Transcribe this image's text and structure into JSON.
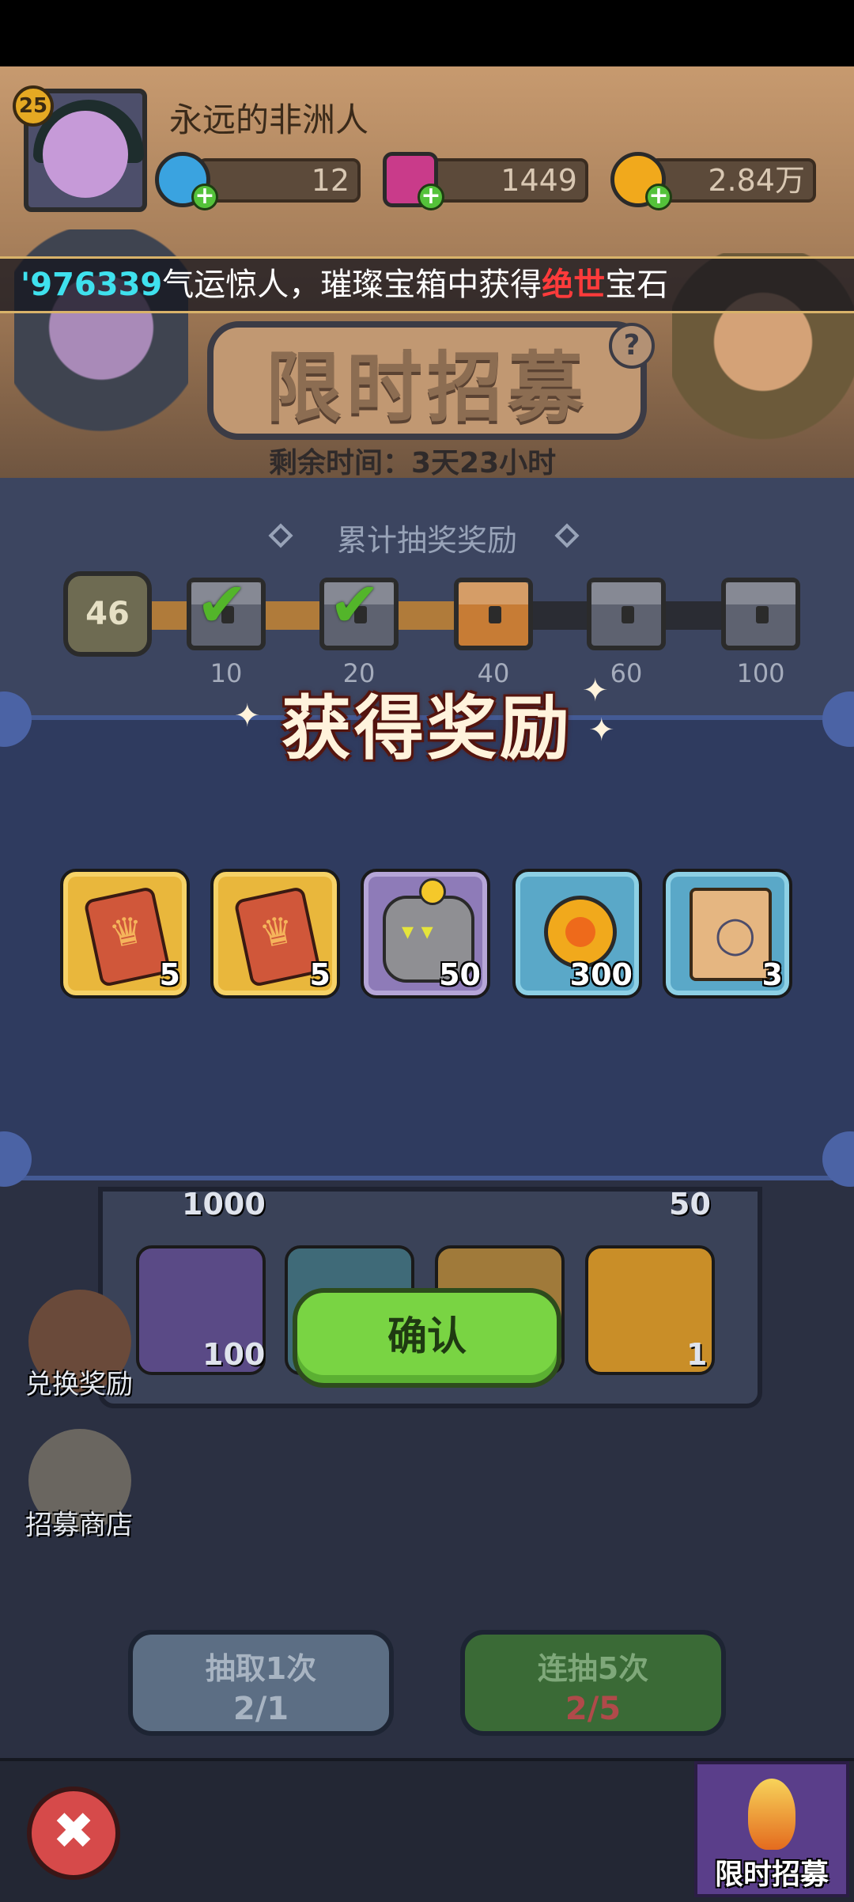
{
  "player": {
    "level": "25",
    "name": "永远的非洲人"
  },
  "resources": [
    {
      "name": "energy",
      "value": "12",
      "color": "#3aa3e0"
    },
    {
      "name": "gem",
      "value": "1449",
      "color": "#c93b8a"
    },
    {
      "name": "gold",
      "value": "2.84万",
      "color": "#f1a91c"
    }
  ],
  "ticker": {
    "id": "'976339",
    "text1": "气运惊人，璀璨宝箱中获得",
    "highlight": "绝世",
    "text2": "宝石"
  },
  "event": {
    "title": "限时招募",
    "remaining_time": "剩余时间：3天23小时"
  },
  "cumulative": {
    "title": "累计抽奖奖励",
    "current": "46",
    "milestones": [
      {
        "value": "10",
        "state": "claimed"
      },
      {
        "value": "20",
        "state": "claimed"
      },
      {
        "value": "40",
        "state": "available"
      },
      {
        "value": "60",
        "state": "locked"
      },
      {
        "value": "100",
        "state": "locked"
      }
    ]
  },
  "reward_popup": {
    "title": "获得奖励",
    "items": [
      {
        "icon": "crown-card-icon",
        "count": "5"
      },
      {
        "icon": "crown-card-icon",
        "count": "5"
      },
      {
        "icon": "golem-hero-icon",
        "count": "50"
      },
      {
        "icon": "gold-coin-icon",
        "count": "300"
      },
      {
        "icon": "ring-scroll-icon",
        "count": "3"
      }
    ],
    "confirm_label": "确认"
  },
  "background_grid": {
    "counts": [
      "1000",
      "50",
      "100",
      "1"
    ]
  },
  "side_buttons": {
    "exchange": "兑换奖励",
    "shop": "招募商店"
  },
  "draw_buttons": {
    "single": {
      "label": "抽取1次",
      "cost": "2/1"
    },
    "multi": {
      "label": "连抽5次",
      "cost": "2/5"
    }
  },
  "bottom_tab": {
    "label": "限时招募"
  }
}
